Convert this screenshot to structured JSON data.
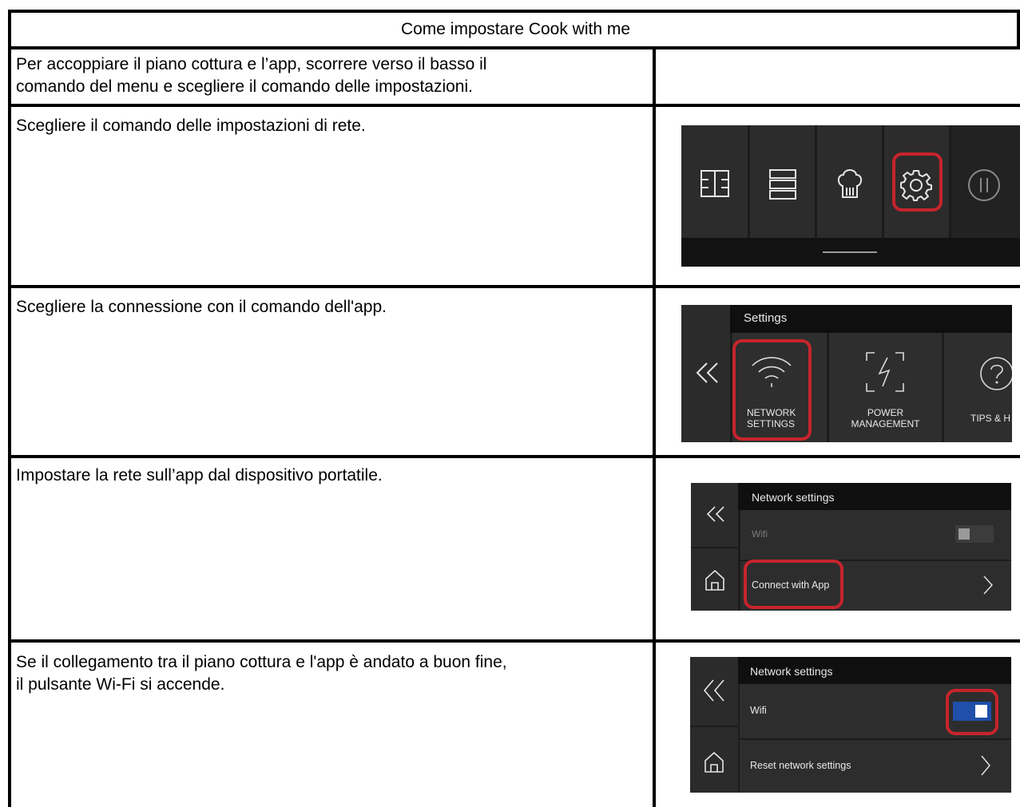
{
  "title": "Come impostare Cook with me",
  "rows": [
    {
      "text": "Per accoppiare il piano cottura e l’app, scorrere verso il basso il\ncomando del menu e scegliere il comando delle impostazioni."
    },
    {
      "text": "Scegliere il comando delle impostazioni di rete."
    },
    {
      "text": "Scegliere la connessione con il comando dell'app."
    },
    {
      "text": "Impostare la rete sull’app dal dispositivo portatile."
    },
    {
      "text": "Se il collegamento tra il piano cottura e l'app è andato a buon fine,\nil pulsante Wi-Fi si accende."
    }
  ],
  "screens": {
    "menu": {
      "icons": [
        "zones-icon",
        "list-icon",
        "chef-hat-icon",
        "gear-icon",
        "power-icon"
      ],
      "highlighted": "gear-icon"
    },
    "settings": {
      "header": "Settings",
      "tiles": [
        {
          "label": "NETWORK\nSETTINGS",
          "icon": "wifi-icon"
        },
        {
          "label": "POWER\nMANAGEMENT",
          "icon": "power-management-icon"
        },
        {
          "label": "TIPS & H",
          "icon": "help-icon"
        }
      ],
      "highlighted": "NETWORK SETTINGS"
    },
    "network1": {
      "header": "Network settings",
      "wifi_label": "Wifi",
      "wifi_on": false,
      "action_label": "Connect with App"
    },
    "network2": {
      "header": "Network settings",
      "wifi_label": "Wifi",
      "wifi_on": true,
      "action_label": "Reset network settings"
    }
  },
  "colors": {
    "highlight": "#c6242c",
    "toggle_on": "#1f4fa8",
    "panel_bg": "#262626"
  }
}
